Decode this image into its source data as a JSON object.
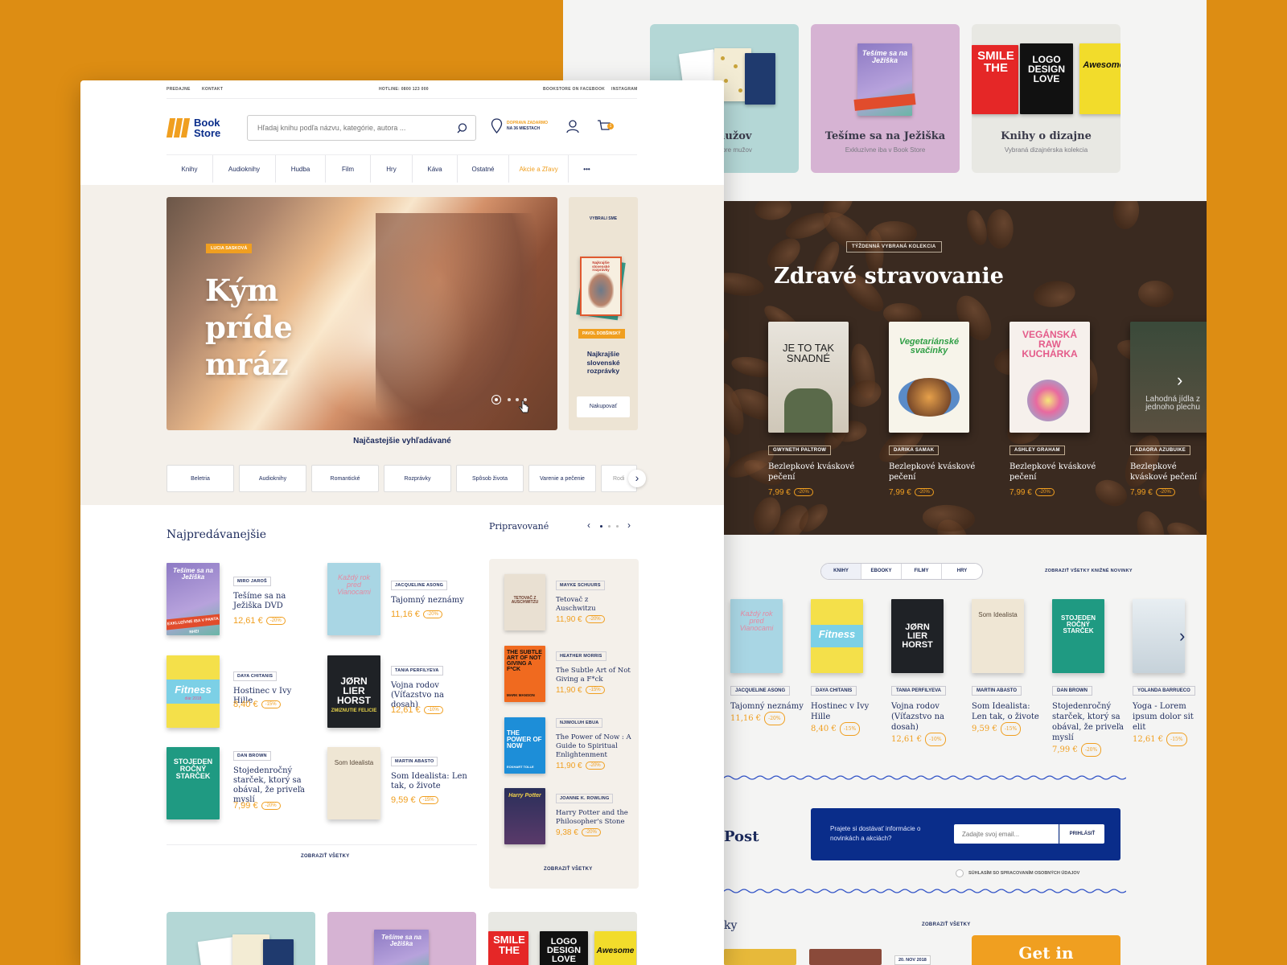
{
  "back": {
    "categories": [
      {
        "title": "Knihy pre mužov",
        "title_visible": "re mužov",
        "subtitle": "h titov pre mužov"
      },
      {
        "title": "Tešíme sa na Ježiška",
        "subtitle": "Exkluzívne iba v Book Store"
      },
      {
        "title": "Knihy o dizajne",
        "subtitle": "Vybraná dizajnérska kolekcia"
      }
    ],
    "collection": {
      "badge": "TÝŽDENNÁ VYBRANÁ KOLEKCIA",
      "title": "Zdravé stravovanie",
      "books": [
        {
          "author": "GWYNETH PALTROW",
          "name": "Bezlepkové kváskové pečení",
          "price": "7,99 €",
          "discount": "-20%",
          "cover": "JE TO TAK SNADNÉ"
        },
        {
          "author": "DARIKA SAMAK",
          "name": "Bezlepkové kváskové pečení",
          "price": "7,99 €",
          "discount": "-20%",
          "cover": "Vegetariánské svačinky"
        },
        {
          "author": "ASHLEY GRAHAM",
          "name": "Bezlepkové kváskové pečení",
          "price": "7,99 €",
          "discount": "-20%",
          "cover": "VEGÁNSKÁ RAW KUCHÁRKA"
        },
        {
          "author": "ADAORA AZUBUIKE",
          "name": "Bezlepkové kváskové pečení",
          "price": "7,99 €",
          "discount": "-20%",
          "cover": "Lahodná jídla z jednoho plechu"
        }
      ]
    },
    "new_tabs": [
      "KNIHY",
      "EBOOKY",
      "FILMY",
      "HRY"
    ],
    "new_link": "ZOBRAZIŤ VŠETKY KNIŽNÉ NOVINKY",
    "new_books": [
      {
        "author": "JACQUELINE ASONG",
        "name": "Tajomný neznámy",
        "price": "11,16 €",
        "discount": "-20%"
      },
      {
        "author": "DAYA CHITANIS",
        "name": "Hostinec v Ivy Hille",
        "price": "8,40 €",
        "discount": "-15%"
      },
      {
        "author": "TANIA PERFILYEVA",
        "name": "Vojna rodov (Víťazstvo na dosah)",
        "price": "12,61 €",
        "discount": "-10%"
      },
      {
        "author": "MARTIN ABASTO",
        "name": "Som Idealista: Len tak, o živote",
        "price": "9,59 €",
        "discount": "-15%"
      },
      {
        "author": "DAN BROWN",
        "name": "Stojedenročný starček, ktorý sa obával, že priveľa myslí",
        "price": "7,99 €",
        "discount": "-20%"
      },
      {
        "author": "YOLANDA BARRUECO",
        "name": "Yoga - Lorem ipsum dolor sit elit",
        "price": "12,61 €",
        "discount": "-15%"
      }
    ],
    "newsletter": {
      "post_label": "Post",
      "text": "Prajete si dostávať informácie o novinkách a akciách?",
      "placeholder": "Zadajte svoj email...",
      "button": "PRIHLÁSIŤ",
      "consent": "SÚHLASÍM SO SPRACOVANÍM OSOBNÝCH ÚDAJOV"
    },
    "bottom": {
      "label": "ky",
      "link": "ZOBRAZIŤ VŠETKY",
      "date": "20. NOV 2018",
      "cta": "Get in"
    }
  },
  "front": {
    "topbar": {
      "left": [
        "PREDAJNE",
        "KONTAKT"
      ],
      "hotline": "HOTLINE: 0800 123 000",
      "right": [
        "BOOKSTORE ON FACEBOOK",
        "INSTAGRAM"
      ]
    },
    "logo": {
      "line1": "Book",
      "line2": "Store"
    },
    "search": {
      "placeholder": "Hľadaj knihu podľa názvu, kategórie, autora ..."
    },
    "delivery": {
      "line1": "DOPRAVA ZADARMO",
      "line2": "NA 36 MIESTACH"
    },
    "cart_count": "1",
    "nav": [
      "Knihy",
      "Audioknihy",
      "Hudba",
      "Film",
      "Hry",
      "Káva",
      "Ostatné",
      "Akcie a Zľavy",
      "•••"
    ],
    "hero": {
      "author": "LUCIA SASKOVÁ",
      "title1": "Kým",
      "title2": "príde",
      "title3": "mráz"
    },
    "picked": {
      "label": "VYBRALI SME",
      "author": "PAVOL DOBŠINSKÝ",
      "title": "Najkrajšie slovenské rozprávky",
      "button": "Nakupovať",
      "cover": "Najkrajšie slovenské rozprávky"
    },
    "popular": {
      "title": "Najčastejšie vyhľadávané",
      "chips": [
        "Beletria",
        "Audioknihy",
        "Romantické",
        "Rozprávky",
        "Spôsob života",
        "Varenie a pečenie",
        "Rodi"
      ]
    },
    "bestsellers": {
      "title": "Najpredávanejšie",
      "books": [
        {
          "author": "MIRO JAROŠ",
          "name": "Tešíme sa na Ježiška DVD",
          "price": "12,61 €",
          "discount": "-20%"
        },
        {
          "author": "JACQUELINE ASONG",
          "name": "Tajomný neznámy",
          "price": "11,16 €",
          "discount": "-20%"
        },
        {
          "author": "DAYA CHITANIS",
          "name": "Hostinec v Ivy Hille",
          "price": "8,40 €",
          "discount": "-15%"
        },
        {
          "author": "TANIA PERFILYEVA",
          "name": "Vojna rodov (Víťazstvo na dosah)",
          "price": "12,61 €",
          "discount": "-10%"
        },
        {
          "author": "DAN BROWN",
          "name": "Stojedenročný starček, ktorý sa obával, že priveľa myslí",
          "price": "7,99 €",
          "discount": "-20%"
        },
        {
          "author": "MARTIN ABASTO",
          "name": "Som Idealista: Len tak, o živote",
          "price": "9,59 €",
          "discount": "-15%"
        }
      ],
      "link": "ZOBRAZIŤ VŠETKY"
    },
    "upcoming": {
      "title": "Pripravované",
      "books": [
        {
          "author": "MAYKE SCHUURS",
          "name": "Tetovač z Auschwitzu",
          "price": "11,90 €",
          "discount": "-20%"
        },
        {
          "author": "HEATHER MORRIS",
          "name": "The Subtle Art of Not Giving a F*ck",
          "price": "11,90 €",
          "discount": "-15%"
        },
        {
          "author": "NJIMOLUH EBUA",
          "name": "The Power of Now : A Guide to Spiritual Enlightenment",
          "price": "11,90 €",
          "discount": "-20%"
        },
        {
          "author": "JOANNE K. ROWLING",
          "name": "Harry Potter and the Philosopher's Stone",
          "price": "9,38 €",
          "discount": "-20%"
        }
      ],
      "link": "ZOBRAZIŤ VŠETKY"
    },
    "covers": {
      "jezis": "Tešíme sa na Ježiška",
      "jezis_band": "EXKLUZÍVNE IBA V PANTA RHEI",
      "kazdy": "Každý rok pred Vianocami",
      "fitness": "Fitness",
      "fitness_sub": "diár 2018",
      "horst": "JØRN LIER HORST",
      "horst_sub": "ZMIZNUTIE FELICIE",
      "stojed": "STOJEDEN ROČNÝ STARČEK",
      "som": "Som Idealista",
      "tetovac": "TETOVAČ Z AUSCHWITZU",
      "subtle": "THE SUBTLE ART OF NOT GIVING A F*CK",
      "subtle_author": "MARK MANSON",
      "power": "THE POWER OF NOW",
      "power_author": "ECKHART TOLLE",
      "hp": "Harry Potter",
      "smile": "SMILE THE",
      "logo_design": "LOGO DESIGN LOVE",
      "awesome": "Awesome"
    }
  }
}
